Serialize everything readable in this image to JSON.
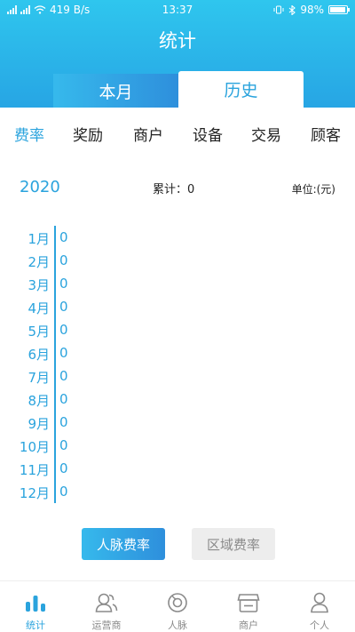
{
  "status_bar": {
    "network": "419 B/s",
    "time": "13:37",
    "battery": "98%"
  },
  "title": "统计",
  "segments": {
    "left": "本月",
    "right": "历史"
  },
  "categories": [
    {
      "label": "费率",
      "active": true
    },
    {
      "label": "奖励",
      "active": false
    },
    {
      "label": "商户",
      "active": false
    },
    {
      "label": "设备",
      "active": false
    },
    {
      "label": "交易",
      "active": false
    },
    {
      "label": "顾客",
      "active": false
    }
  ],
  "summary": {
    "year": "2020",
    "total": "累计：0",
    "unit": "单位:(元)"
  },
  "months": [
    {
      "month": "1月",
      "value": "0"
    },
    {
      "month": "2月",
      "value": "0"
    },
    {
      "month": "3月",
      "value": "0"
    },
    {
      "month": "4月",
      "value": "0"
    },
    {
      "month": "5月",
      "value": "0"
    },
    {
      "month": "6月",
      "value": "0"
    },
    {
      "month": "7月",
      "value": "0"
    },
    {
      "month": "8月",
      "value": "0"
    },
    {
      "month": "9月",
      "value": "0"
    },
    {
      "month": "10月",
      "value": "0"
    },
    {
      "month": "11月",
      "value": "0"
    },
    {
      "month": "12月",
      "value": "0"
    }
  ],
  "buttons": {
    "primary": "人脉费率",
    "secondary": "区域费率"
  },
  "tabbar": [
    {
      "label": "统计",
      "icon": "bar-chart-icon",
      "active": true
    },
    {
      "label": "运营商",
      "icon": "operator-icon",
      "active": false
    },
    {
      "label": "人脉",
      "icon": "network-icon",
      "active": false
    },
    {
      "label": "商户",
      "icon": "shop-icon",
      "active": false
    },
    {
      "label": "个人",
      "icon": "person-icon",
      "active": false
    }
  ],
  "colors": {
    "accent": "#2aa3dd",
    "header_top": "#2fc6ee",
    "header_bottom": "#27a5e4",
    "inactive": "#8a8a8a"
  }
}
